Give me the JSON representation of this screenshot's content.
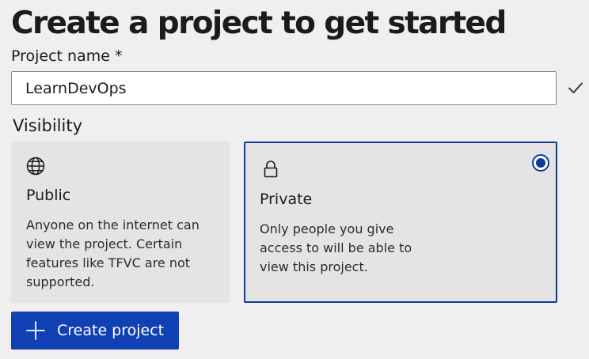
{
  "page": {
    "title": "Create a project to get started"
  },
  "form": {
    "project_name_label": "Project name *",
    "project_name_value": "LearnDevOps",
    "project_name_valid_icon": "check-icon",
    "visibility_label": "Visibility"
  },
  "visibility_options": [
    {
      "icon": "globe-icon",
      "title": "Public",
      "description": "Anyone on the internet can view the project. Certain features like TFVC are not supported.",
      "selected": false
    },
    {
      "icon": "lock-icon",
      "title": "Private",
      "description": "Only people you give access to will be able to view this project.",
      "selected": true
    }
  ],
  "actions": {
    "create_label": "Create project",
    "create_icon": "plus-icon"
  },
  "colors": {
    "accent": "#0e3a9b",
    "button_bg": "#1040b4",
    "page_bg": "#efefef",
    "card_bg": "#e4e4e4",
    "input_border": "#9a8068"
  }
}
